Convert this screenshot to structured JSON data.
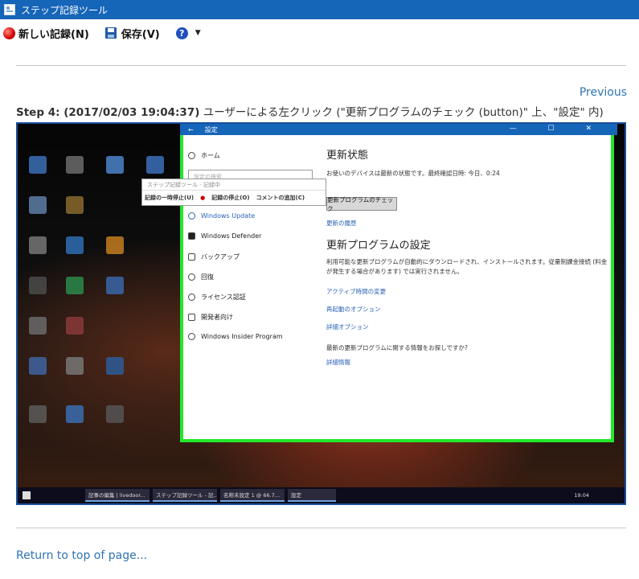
{
  "window": {
    "title": "ステップ記録ツール"
  },
  "toolbar": {
    "new_record_label": "新しい記録(N)",
    "save_label": "保存(V)",
    "help_glyph": "?",
    "dropdown_glyph": "▼"
  },
  "nav": {
    "previous_label": "Previous",
    "return_label": "Return to top of page..."
  },
  "step": {
    "heading": "Step 4: (2017/02/03 19:04:37)",
    "description": " ユーザーによる左クリック (\"更新プログラムのチェック (button)\" 上、\"設定\" 内)"
  },
  "screenshot": {
    "settings_window_title": "設定",
    "window_controls": "— ☐ ✕",
    "search_placeholder": "設定の検索",
    "nav_items": [
      {
        "label": "ホーム",
        "icon": "gear-icon"
      },
      {
        "label": "Windows Update",
        "icon": "refresh-icon",
        "active": true
      },
      {
        "label": "Windows Defender",
        "icon": "shield-icon"
      },
      {
        "label": "バックアップ",
        "icon": "backup-icon"
      },
      {
        "label": "回復",
        "icon": "history-icon"
      },
      {
        "label": "ライセンス認証",
        "icon": "check-circle-icon"
      },
      {
        "label": "開発者向け",
        "icon": "sliders-icon"
      },
      {
        "label": "Windows Insider Program",
        "icon": "person-icon"
      }
    ],
    "update_status_heading": "更新状態",
    "update_status_text": "お使いのデバイスは最新の状態です。最終確認日時: 今日、0:24",
    "check_button_label": "更新プログラムのチェック",
    "history_link": "更新の履歴",
    "settings_heading": "更新プログラムの設定",
    "settings_text": "利用可能な更新プログラムが自動的にダウンロードされ、インストールされます。従量制課金接続 (料金が発生する場合があります) では実行されません。",
    "links": [
      "アクティブ時間の変更",
      "再起動のオプション",
      "詳細オプション"
    ],
    "info_question": "最新の更新プログラムに関する情報をお探しですか?",
    "info_link": "詳細情報",
    "psr": {
      "title": "ステップ記録ツール - 記録中",
      "pause_label": "記録の一時停止(U)",
      "stop_label": "記録の停止(O)",
      "comment_label": "コメントの追加(C)"
    },
    "taskbar": {
      "items": [
        "記事の編集 | livedoor...",
        "ステップ記録ツール - 記...",
        "名称未設定 1 @ 66.7...",
        "設定"
      ],
      "clock": "19:04"
    }
  }
}
